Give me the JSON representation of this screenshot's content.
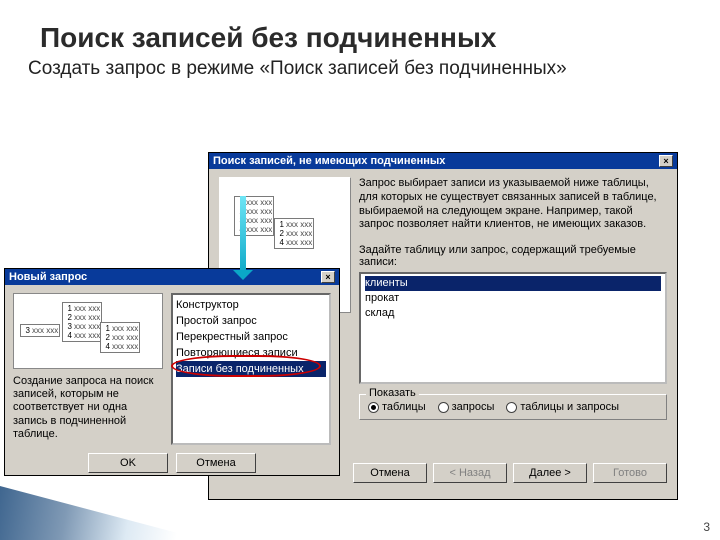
{
  "slide": {
    "title": "Поиск записей без подчиненных",
    "subtitle": "Создать запрос в режиме «Поиск записей без подчиненных»",
    "pagenum": "3"
  },
  "wizard": {
    "title": "Поиск записей, не имеющих подчиненных",
    "desc": "Запрос выбирает записи из указываемой ниже таблицы, для которых не существует связанных записей в таблице, выбираемой на следующем экране. Например, такой запрос позволяет найти клиентов, не имеющих заказов.",
    "prompt": "Задайте таблицу или запрос, содержащий требуемые записи:",
    "list": [
      "клиенты",
      "прокат",
      "склад"
    ],
    "selected": "клиенты",
    "group_label": "Показать",
    "radios": {
      "tables": "таблицы",
      "queries": "запросы",
      "both": "таблицы и запросы"
    },
    "buttons": {
      "cancel": "Отмена",
      "back": "< Назад",
      "next": "Далее >",
      "finish": "Готово"
    },
    "close": "×"
  },
  "newquery": {
    "title": "Новый запрос",
    "desc": "Создание запроса на поиск записей, которым не соответствует ни одна запись в подчиненной таблице.",
    "options": [
      "Конструктор",
      "Простой запрос",
      "Перекрестный запрос",
      "Повторяющиеся записи",
      "Записи без подчиненных"
    ],
    "selected": "Записи без подчиненных",
    "buttons": {
      "ok": "OK",
      "cancel": "Отмена"
    },
    "close": "×",
    "preview_label": "xxx xxx"
  }
}
